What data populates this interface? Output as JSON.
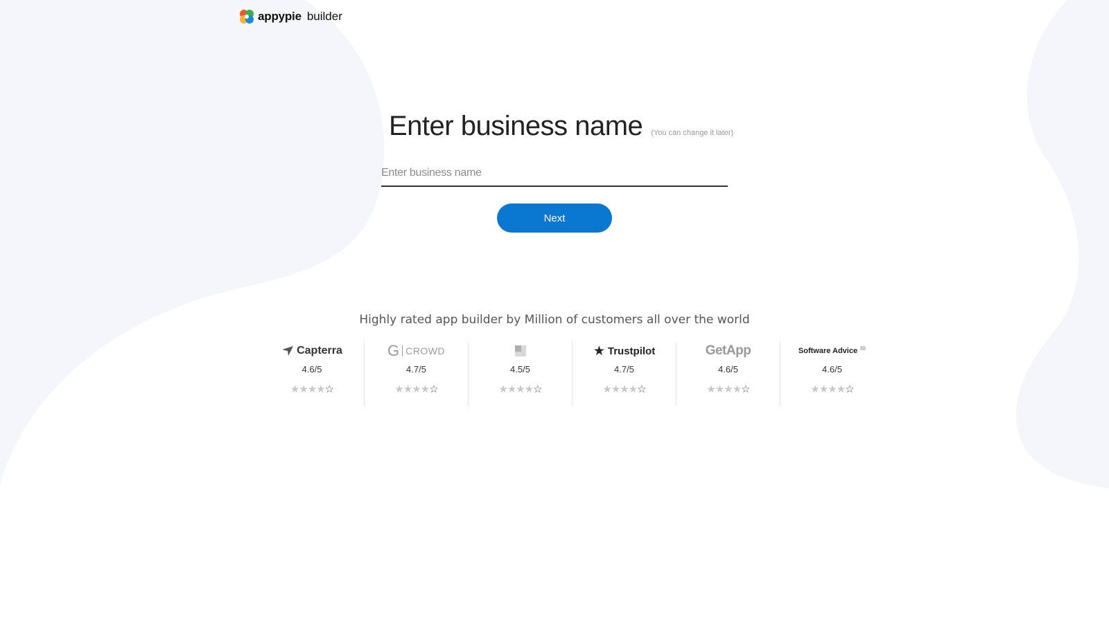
{
  "header": {
    "brand": "appypie",
    "product": "builder"
  },
  "form": {
    "title": "Enter business name",
    "note": "(You can change it later)",
    "input_placeholder": "Enter business name",
    "input_value": "",
    "next_label": "Next"
  },
  "tagline": "Highly rated app builder by Million of customers all over the world",
  "ratings": [
    {
      "name": "Capterra",
      "score": "4.6/5",
      "stars_filled": 4
    },
    {
      "name": "CROWD",
      "score": "4.7/5",
      "stars_filled": 4
    },
    {
      "name": "",
      "score": "4.5/5",
      "stars_filled": 4
    },
    {
      "name": "Trustpilot",
      "score": "4.7/5",
      "stars_filled": 4
    },
    {
      "name": "GetApp",
      "score": "4.6/5",
      "stars_filled": 4
    },
    {
      "name": "Software Advice",
      "score": "4.6/5",
      "stars_filled": 4
    }
  ],
  "colors": {
    "accent": "#0a78d1",
    "background_shape": "#f5f6fb"
  }
}
